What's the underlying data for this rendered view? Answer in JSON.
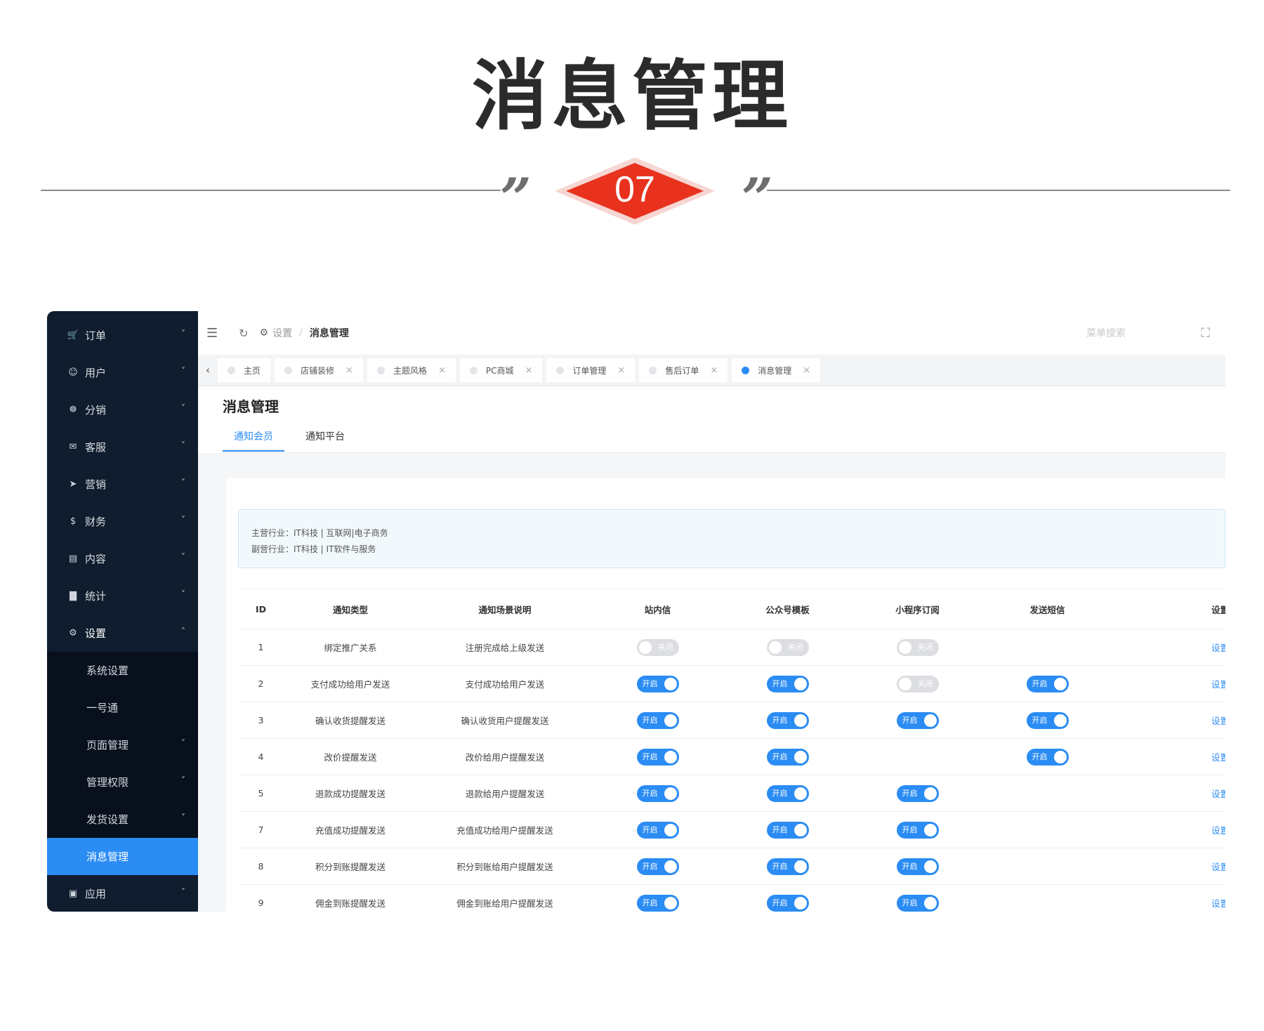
{
  "hero": {
    "title": "消息管理",
    "number": "07",
    "accent_color": "#e8321e"
  },
  "sidebar": {
    "items": [
      {
        "label": "订单",
        "icon": "cart-icon"
      },
      {
        "label": "用户",
        "icon": "user-icon"
      },
      {
        "label": "分销",
        "icon": "distribution-icon"
      },
      {
        "label": "客服",
        "icon": "chat-icon"
      },
      {
        "label": "营销",
        "icon": "send-icon"
      },
      {
        "label": "财务",
        "icon": "dollar-icon"
      },
      {
        "label": "内容",
        "icon": "book-icon"
      },
      {
        "label": "统计",
        "icon": "bar-chart-icon"
      },
      {
        "label": "设置",
        "icon": "gear-icon"
      }
    ],
    "sub_items": [
      {
        "label": "系统设置"
      },
      {
        "label": "一号通"
      },
      {
        "label": "页面管理"
      },
      {
        "label": "管理权限"
      },
      {
        "label": "发货设置"
      },
      {
        "label": "消息管理"
      }
    ],
    "last_item": {
      "label": "应用",
      "icon": "cube-icon"
    },
    "active_color": "#2b8cf3"
  },
  "topbar": {
    "crumb_parent": "设置",
    "crumb_sep": "/",
    "crumb_current": "消息管理",
    "search_placeholder": "菜单搜索"
  },
  "tabs": [
    {
      "label": "主页",
      "closable": false
    },
    {
      "label": "店铺装修",
      "closable": true
    },
    {
      "label": "主题风格",
      "closable": true
    },
    {
      "label": "PC商城",
      "closable": true
    },
    {
      "label": "订单管理",
      "closable": true
    },
    {
      "label": "售后订单",
      "closable": true
    },
    {
      "label": "消息管理",
      "closable": true,
      "active": true
    }
  ],
  "page": {
    "title": "消息管理",
    "sub_tabs": [
      "通知会员",
      "通知平台"
    ],
    "notice_line1": "主营行业：IT科技 | 互联网|电子商务",
    "notice_line2": "副营行业：IT科技 | IT软件与服务"
  },
  "table": {
    "headers": [
      "ID",
      "通知类型",
      "通知场景说明",
      "站内信",
      "公众号模板",
      "小程序订阅",
      "发送短信",
      "设置"
    ],
    "on_label": "开启",
    "off_label": "关闭",
    "rows": [
      {
        "id": "1",
        "type": "绑定推广关系",
        "desc": "注册完成给上级发送",
        "sw": [
          "off",
          "off",
          "off",
          null
        ],
        "set": "设置"
      },
      {
        "id": "2",
        "type": "支付成功给用户发送",
        "desc": "支付成功给用户发送",
        "sw": [
          "on",
          "on",
          "off",
          "on"
        ],
        "set": "设置"
      },
      {
        "id": "3",
        "type": "确认收货提醒发送",
        "desc": "确认收货用户提醒发送",
        "sw": [
          "on",
          "on",
          "on",
          "on"
        ],
        "set": "设置"
      },
      {
        "id": "4",
        "type": "改价提醒发送",
        "desc": "改价给用户提醒发送",
        "sw": [
          "on",
          "on",
          null,
          "on"
        ],
        "set": "设置"
      },
      {
        "id": "5",
        "type": "退款成功提醒发送",
        "desc": "退款给用户提醒发送",
        "sw": [
          "on",
          "on",
          "on",
          null
        ],
        "set": "设置"
      },
      {
        "id": "7",
        "type": "充值成功提醒发送",
        "desc": "充值成功给用户提醒发送",
        "sw": [
          "on",
          "on",
          "on",
          null
        ],
        "set": "设置"
      },
      {
        "id": "8",
        "type": "积分到账提醒发送",
        "desc": "积分到账给用户提醒发送",
        "sw": [
          "on",
          "on",
          "on",
          null
        ],
        "set": "设置"
      },
      {
        "id": "9",
        "type": "佣金到账提醒发送",
        "desc": "佣金到账给用户提醒发送",
        "sw": [
          "on",
          "on",
          "on",
          null
        ],
        "set": "设置"
      }
    ]
  }
}
